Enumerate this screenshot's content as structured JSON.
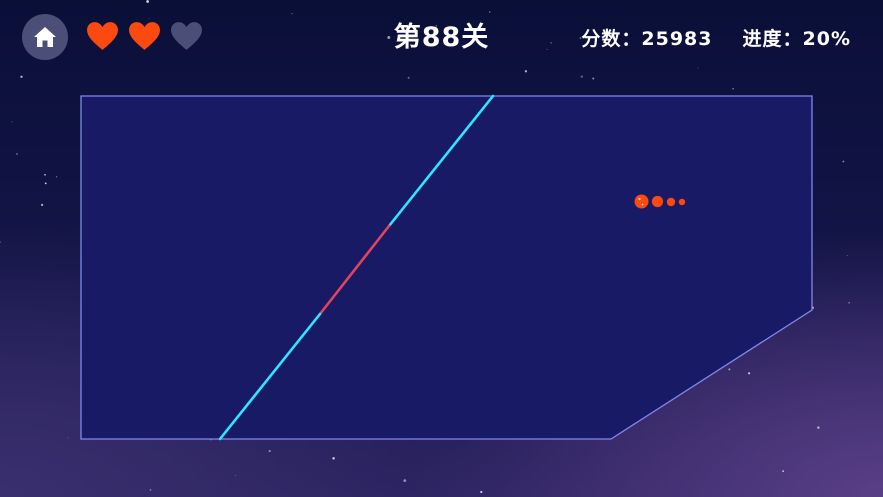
{
  "hud": {
    "home_icon": "home-icon",
    "lives": [
      {
        "icon": "heart-icon",
        "state": "full",
        "color": "#fb4a10"
      },
      {
        "icon": "heart-icon",
        "state": "full",
        "color": "#fb4a10"
      },
      {
        "icon": "heart-icon",
        "state": "empty",
        "color": "#4b4f78"
      }
    ],
    "level_title": "第88关",
    "score_label": "分数：",
    "score_value": "25983",
    "progress_label": "进度：",
    "progress_value": "20%",
    "progress_fraction": 0.2
  },
  "colors": {
    "field_fill": "#181a66",
    "field_border": "#7e88ee",
    "cut_line": "#2fe6ff",
    "cut_danger_segment": "#e0455c",
    "ball": "#fb4a10"
  },
  "game": {
    "ball_icon": "ball-with-trail"
  }
}
